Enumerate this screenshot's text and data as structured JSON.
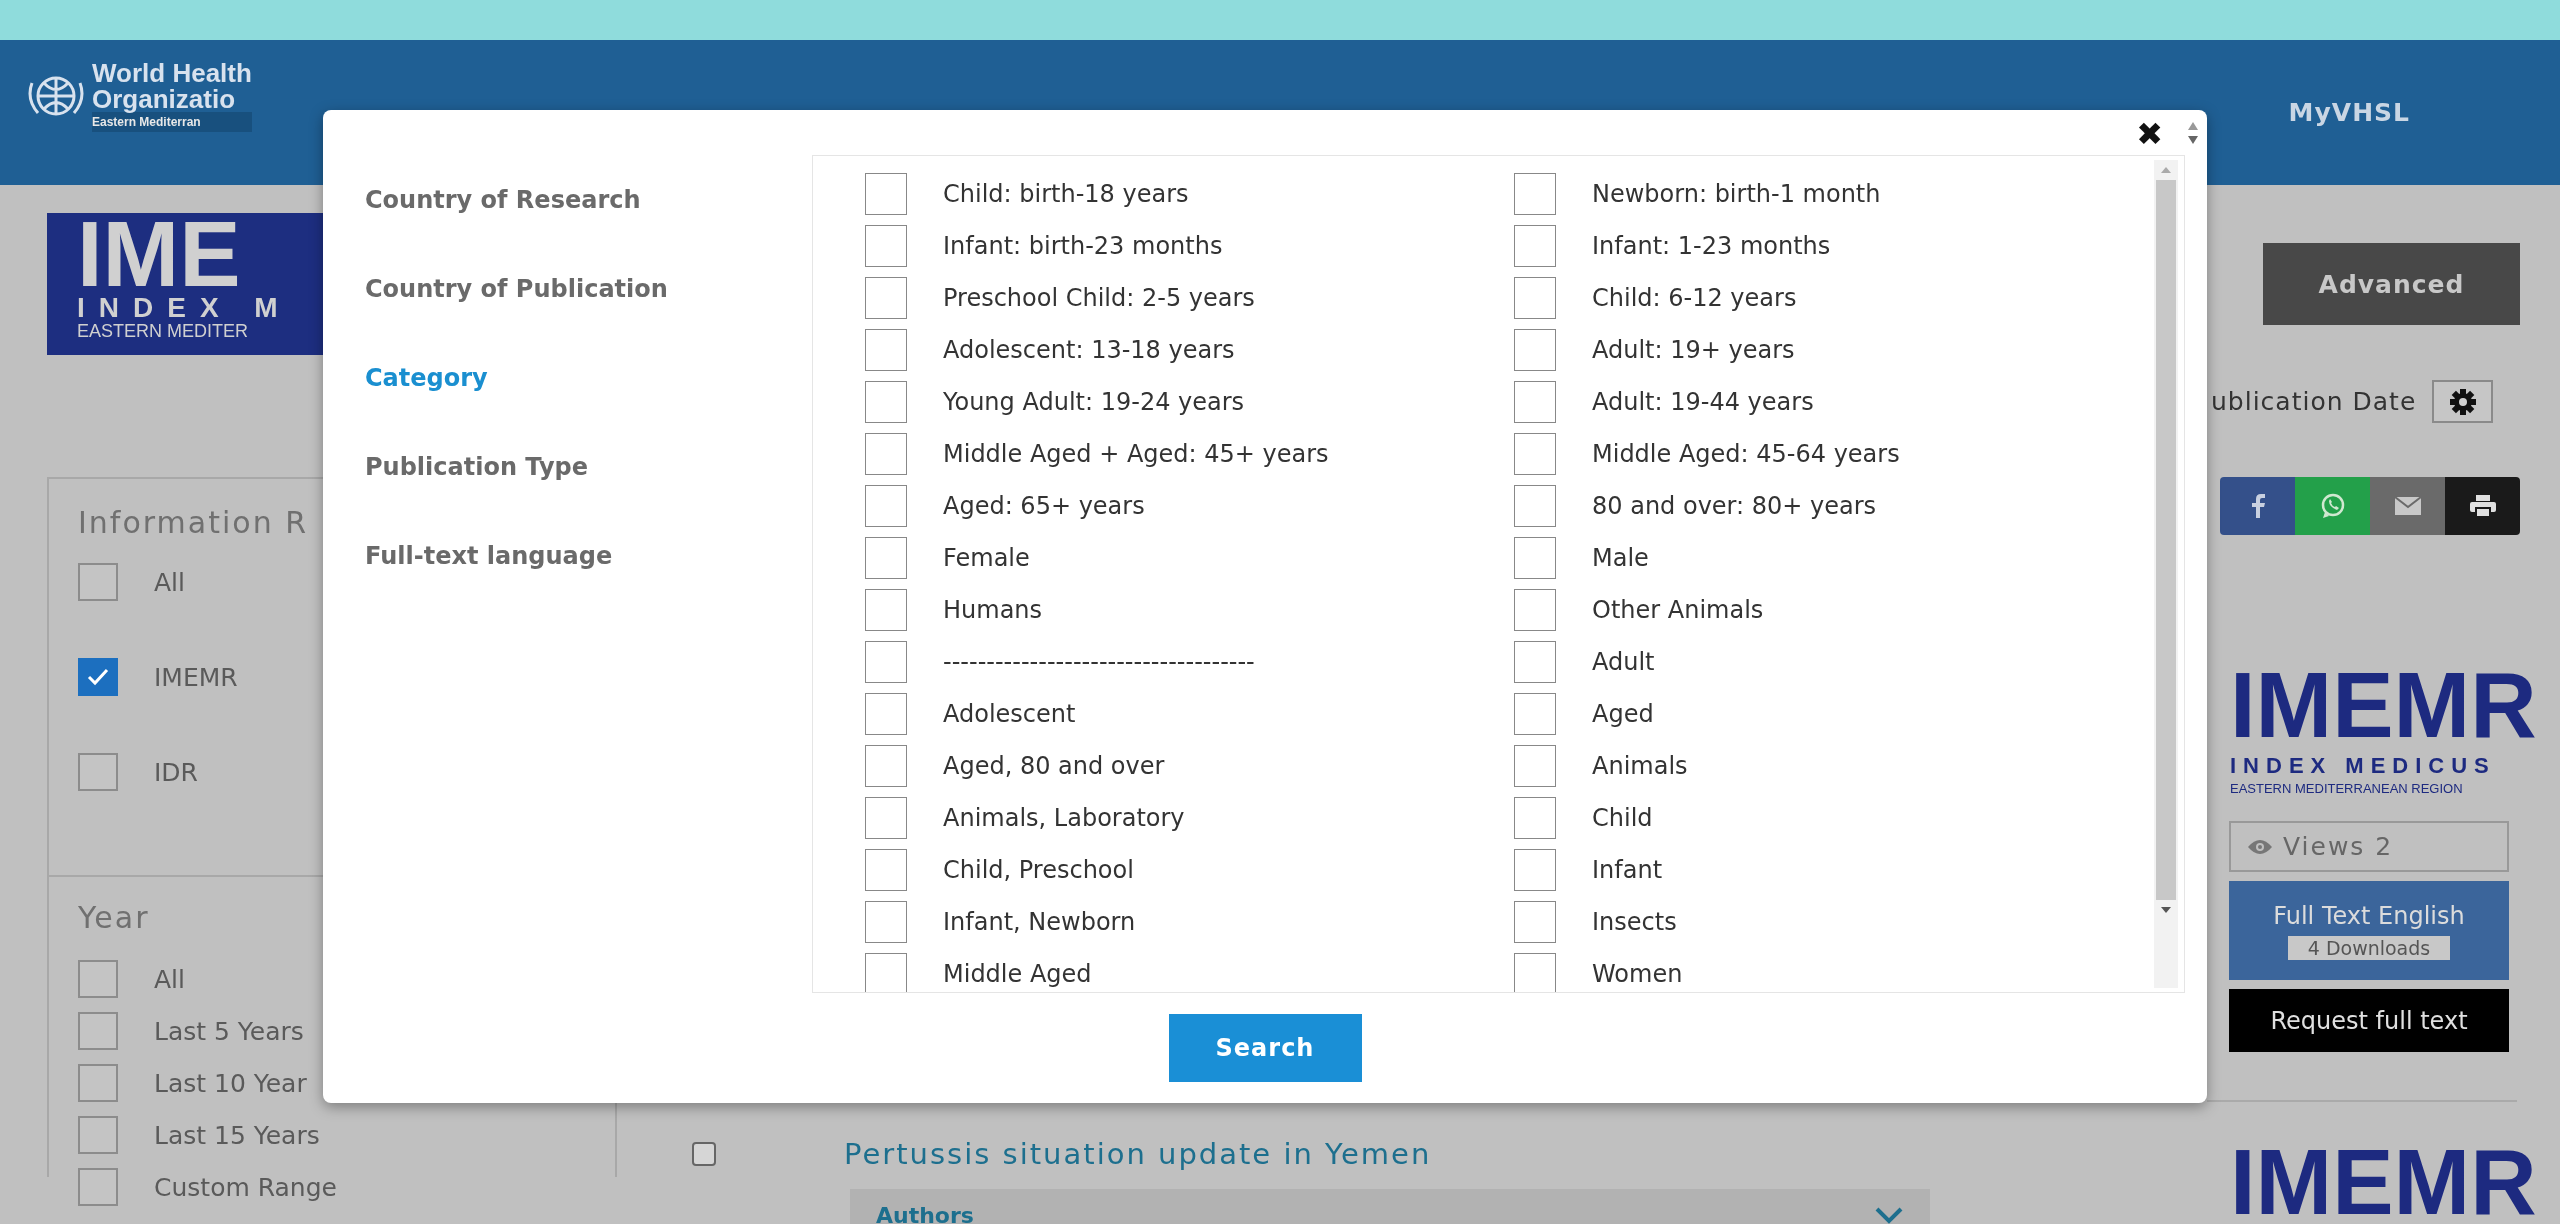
{
  "header": {
    "logo": {
      "line_1": "World Health",
      "line_2": "Organizatio",
      "line_3": "Eastern Mediterran"
    },
    "nav": [
      {
        "label": "MyVHSL"
      }
    ]
  },
  "brand_logo": {
    "title": "IME",
    "subtitle": "INDEX M",
    "region": "EASTERN MEDITER"
  },
  "filters": [
    {
      "heading": "Information R",
      "options": [
        {
          "label": "All",
          "checked": false
        },
        {
          "label": "IMEMR",
          "checked": true
        },
        {
          "label": "IDR",
          "checked": false
        }
      ]
    },
    {
      "heading": "Year",
      "options": [
        {
          "label": "All",
          "checked": false
        },
        {
          "label": "Last 5 Years",
          "checked": false
        },
        {
          "label": "Last 10 Year",
          "checked": false
        },
        {
          "label": "Last 15 Years",
          "checked": false
        },
        {
          "label": "Custom Range",
          "checked": false
        }
      ]
    }
  ],
  "toolbar": {
    "advanced_button": "Advanced",
    "sort_label": "ublication Date",
    "share": [
      {
        "kind": "facebook"
      },
      {
        "kind": "whatsapp"
      },
      {
        "kind": "email"
      },
      {
        "kind": "print"
      }
    ]
  },
  "result": {
    "logo": {
      "title": "IMEMR",
      "subtitle": "INDEX MEDICUS",
      "region": "EASTERN MEDITERRANEAN REGION"
    },
    "views": "Views 2",
    "full_text": "Full Text English",
    "downloads": "4 Downloads",
    "request": "Request full text"
  },
  "result_item": {
    "checked": false,
    "title": "Pertussis situation update in Yemen",
    "section": "Authors",
    "logo_title": "IMEMR"
  },
  "modal": {
    "close": "✖",
    "menu": [
      {
        "label": "Country of Research",
        "selected": false
      },
      {
        "label": "Country of Publication",
        "selected": false
      },
      {
        "label": "Category",
        "selected": true
      },
      {
        "label": "Publication Type",
        "selected": false
      },
      {
        "label": "Full-text language",
        "selected": false
      }
    ],
    "options": [
      {
        "label": "Child: birth-18 years",
        "checked": false
      },
      {
        "label": "Newborn: birth-1 month",
        "checked": false
      },
      {
        "label": "Infant: birth-23 months",
        "checked": false
      },
      {
        "label": "Infant: 1-23 months",
        "checked": false
      },
      {
        "label": "Preschool Child: 2-5 years",
        "checked": false
      },
      {
        "label": "Child: 6-12 years",
        "checked": false
      },
      {
        "label": "Adolescent: 13-18 years",
        "checked": false
      },
      {
        "label": "Adult: 19+ years",
        "checked": false
      },
      {
        "label": "Young Adult: 19-24 years",
        "checked": false
      },
      {
        "label": "Adult: 19-44 years",
        "checked": false
      },
      {
        "label": "Middle Aged + Aged: 45+ years",
        "checked": false
      },
      {
        "label": "Middle Aged: 45-64 years",
        "checked": false
      },
      {
        "label": "Aged: 65+ years",
        "checked": false
      },
      {
        "label": "80 and over: 80+ years",
        "checked": false
      },
      {
        "label": "Female",
        "checked": false
      },
      {
        "label": "Male",
        "checked": false
      },
      {
        "label": "Humans",
        "checked": false
      },
      {
        "label": "Other Animals",
        "checked": false
      },
      {
        "label": "------------------------------------",
        "checked": false
      },
      {
        "label": "Adult",
        "checked": false
      },
      {
        "label": "Adolescent",
        "checked": false
      },
      {
        "label": "Aged",
        "checked": false
      },
      {
        "label": "Aged, 80 and over",
        "checked": false
      },
      {
        "label": "Animals",
        "checked": false
      },
      {
        "label": "Animals, Laboratory",
        "checked": false
      },
      {
        "label": "Child",
        "checked": false
      },
      {
        "label": "Child, Preschool",
        "checked": false
      },
      {
        "label": "Infant",
        "checked": false
      },
      {
        "label": "Infant, Newborn",
        "checked": false
      },
      {
        "label": "Insects",
        "checked": false
      },
      {
        "label": "Middle Aged",
        "checked": false
      },
      {
        "label": "Women",
        "checked": false
      }
    ],
    "button": "Search"
  }
}
